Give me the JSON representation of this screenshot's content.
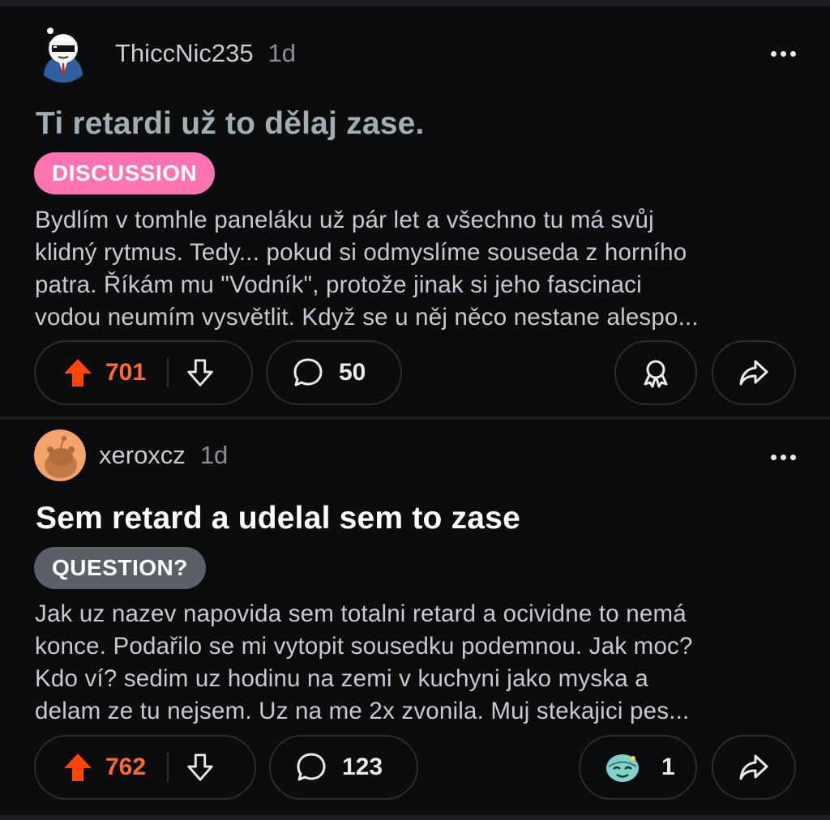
{
  "posts": [
    {
      "username": "ThiccNic235",
      "age": "1d",
      "title": "Ti retardi už to dělaj zase.",
      "flair": "DISCUSSION",
      "body_lines": [
        "Bydlím v tomhle paneláku už pár let a všechno tu má svůj",
        "klidný rytmus. Tedy... pokud si odmyslíme souseda z horního",
        "patra. Říkám mu \"Vodník\", protože jinak si jeho fascinaci",
        "vodou neumím vysvětlit. Když se u něj něco nestane alespo..."
      ],
      "upvotes": "701",
      "comments": "50"
    },
    {
      "username": "xeroxcz",
      "age": "1d",
      "title": "Sem retard a udelal sem to zase",
      "flair": "QUESTION?",
      "body_lines": [
        "Jak uz nazev napovida sem totalni retard a ocividne to nemá",
        "konce. Podařilo se mi vytopit sousedku podemnou. Jak moc?",
        "Kdo ví? sedim uz hodinu na zemi v kuchyni jako myska a",
        "delam ze tu nejsem. Uz na me 2x zvonila. Muj stekajici pes..."
      ],
      "upvotes": "762",
      "comments": "123",
      "awards": "1"
    }
  ],
  "colors": {
    "background": "#0b0c0e",
    "upvote_active": "#ff4500",
    "upvote_count": "#ff6a2f",
    "discussion_flair": "#ff73b3",
    "question_flair": "#5b6068",
    "visited_title": "#a2acb3"
  },
  "icons": [
    "more-icon",
    "upvote-icon",
    "downvote-icon",
    "comment-icon",
    "award-icon",
    "share-icon",
    "award-emoji-icon"
  ]
}
